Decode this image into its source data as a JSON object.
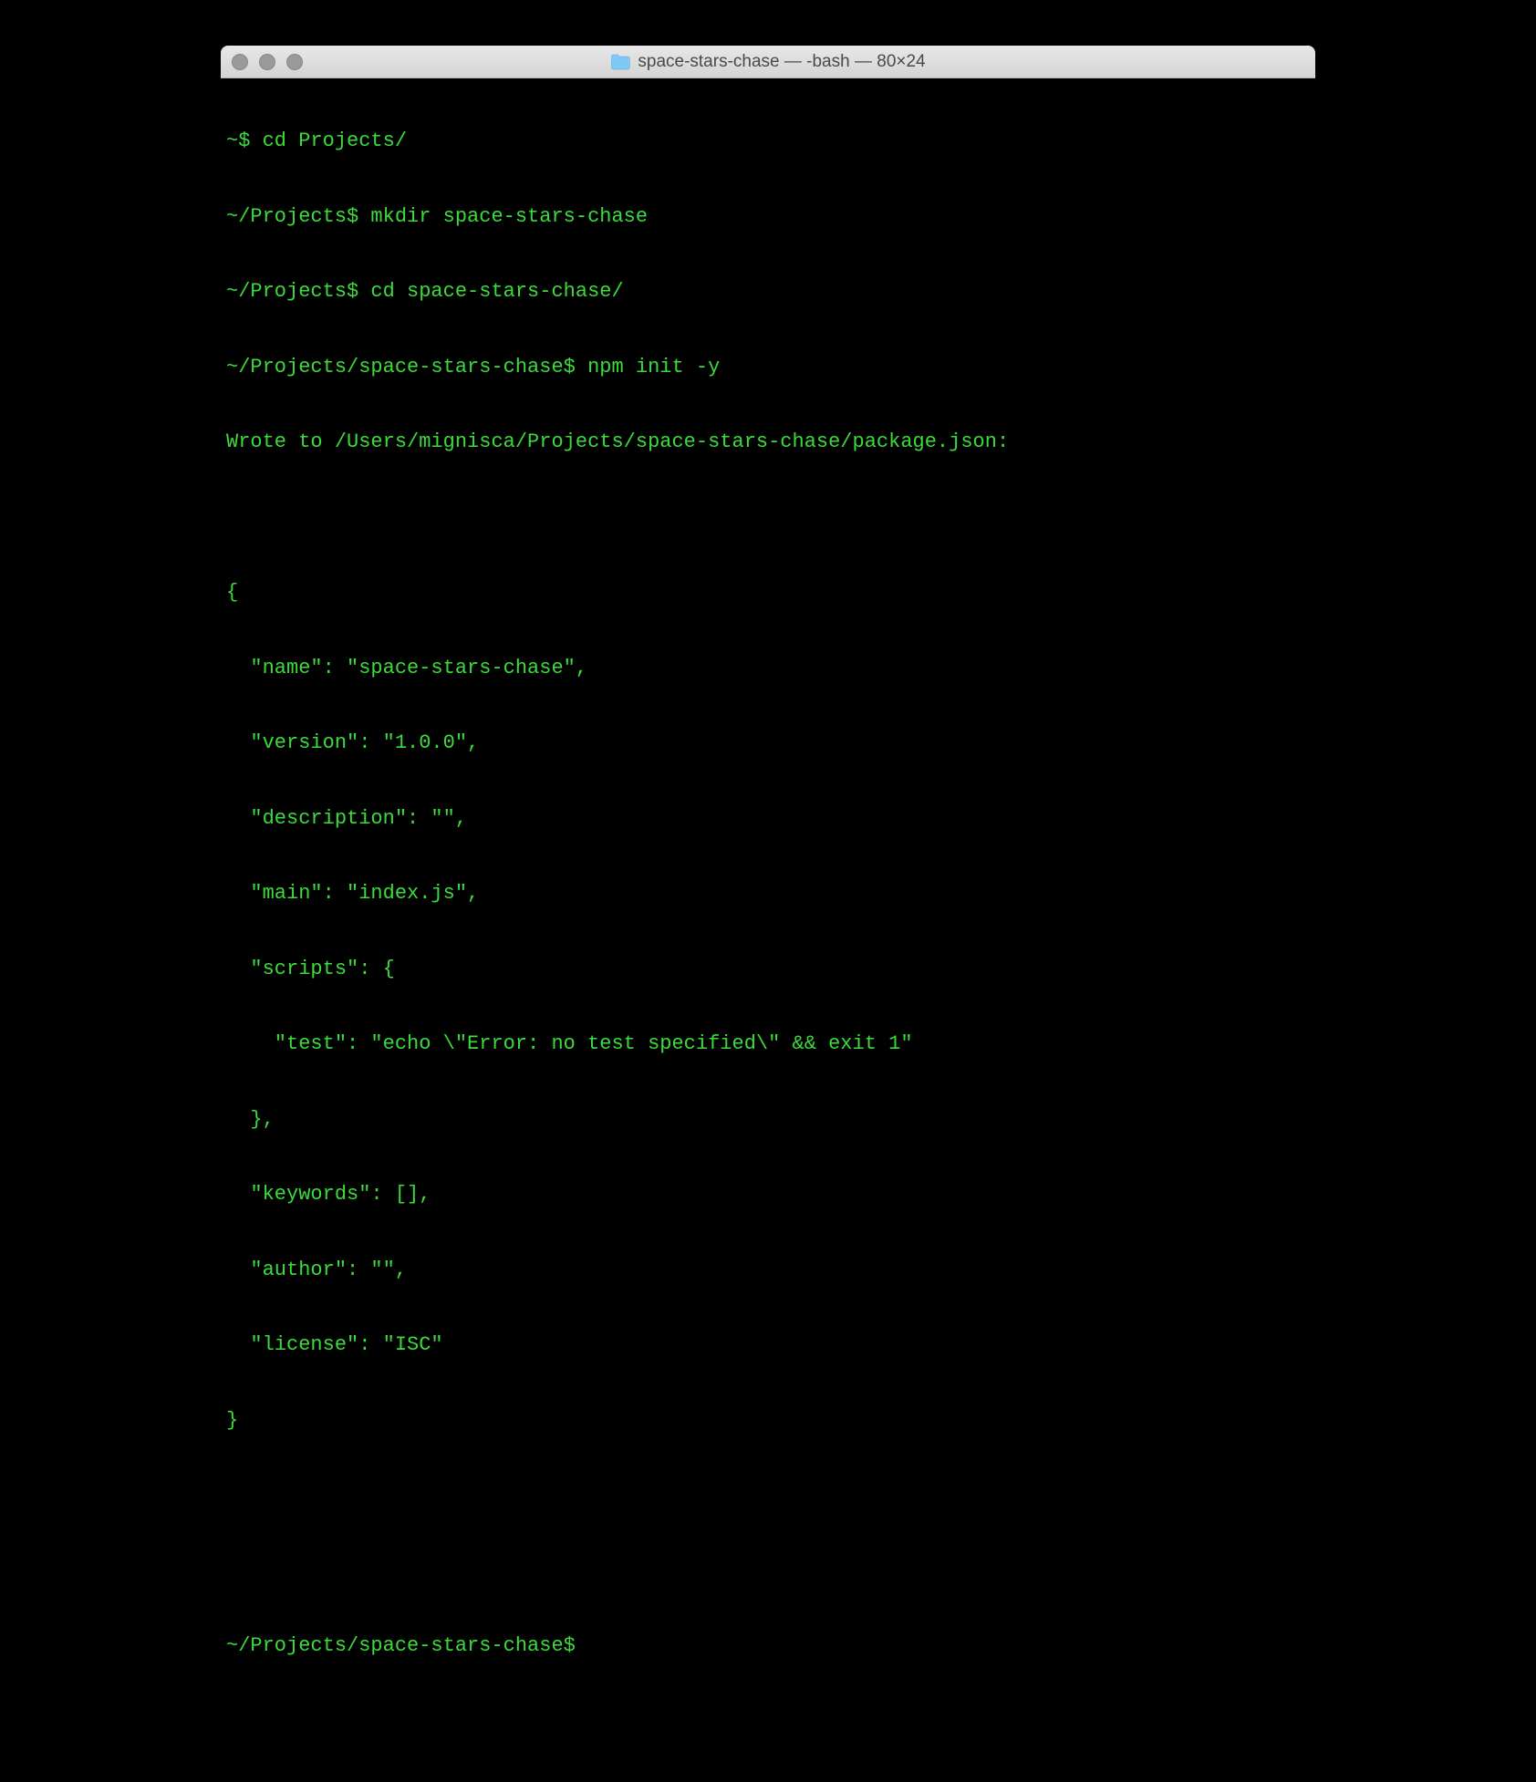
{
  "window": {
    "title": "space-stars-chase — -bash — 80×24"
  },
  "terminal": {
    "lines": [
      "~$ cd Projects/",
      "~/Projects$ mkdir space-stars-chase",
      "~/Projects$ cd space-stars-chase/",
      "~/Projects/space-stars-chase$ npm init -y",
      "Wrote to /Users/mignisca/Projects/space-stars-chase/package.json:",
      "",
      "{",
      "  \"name\": \"space-stars-chase\",",
      "  \"version\": \"1.0.0\",",
      "  \"description\": \"\",",
      "  \"main\": \"index.js\",",
      "  \"scripts\": {",
      "    \"test\": \"echo \\\"Error: no test specified\\\" && exit 1\"",
      "  },",
      "  \"keywords\": [],",
      "  \"author\": \"\",",
      "  \"license\": \"ISC\"",
      "}",
      "",
      "",
      "~/Projects/space-stars-chase$ "
    ]
  }
}
